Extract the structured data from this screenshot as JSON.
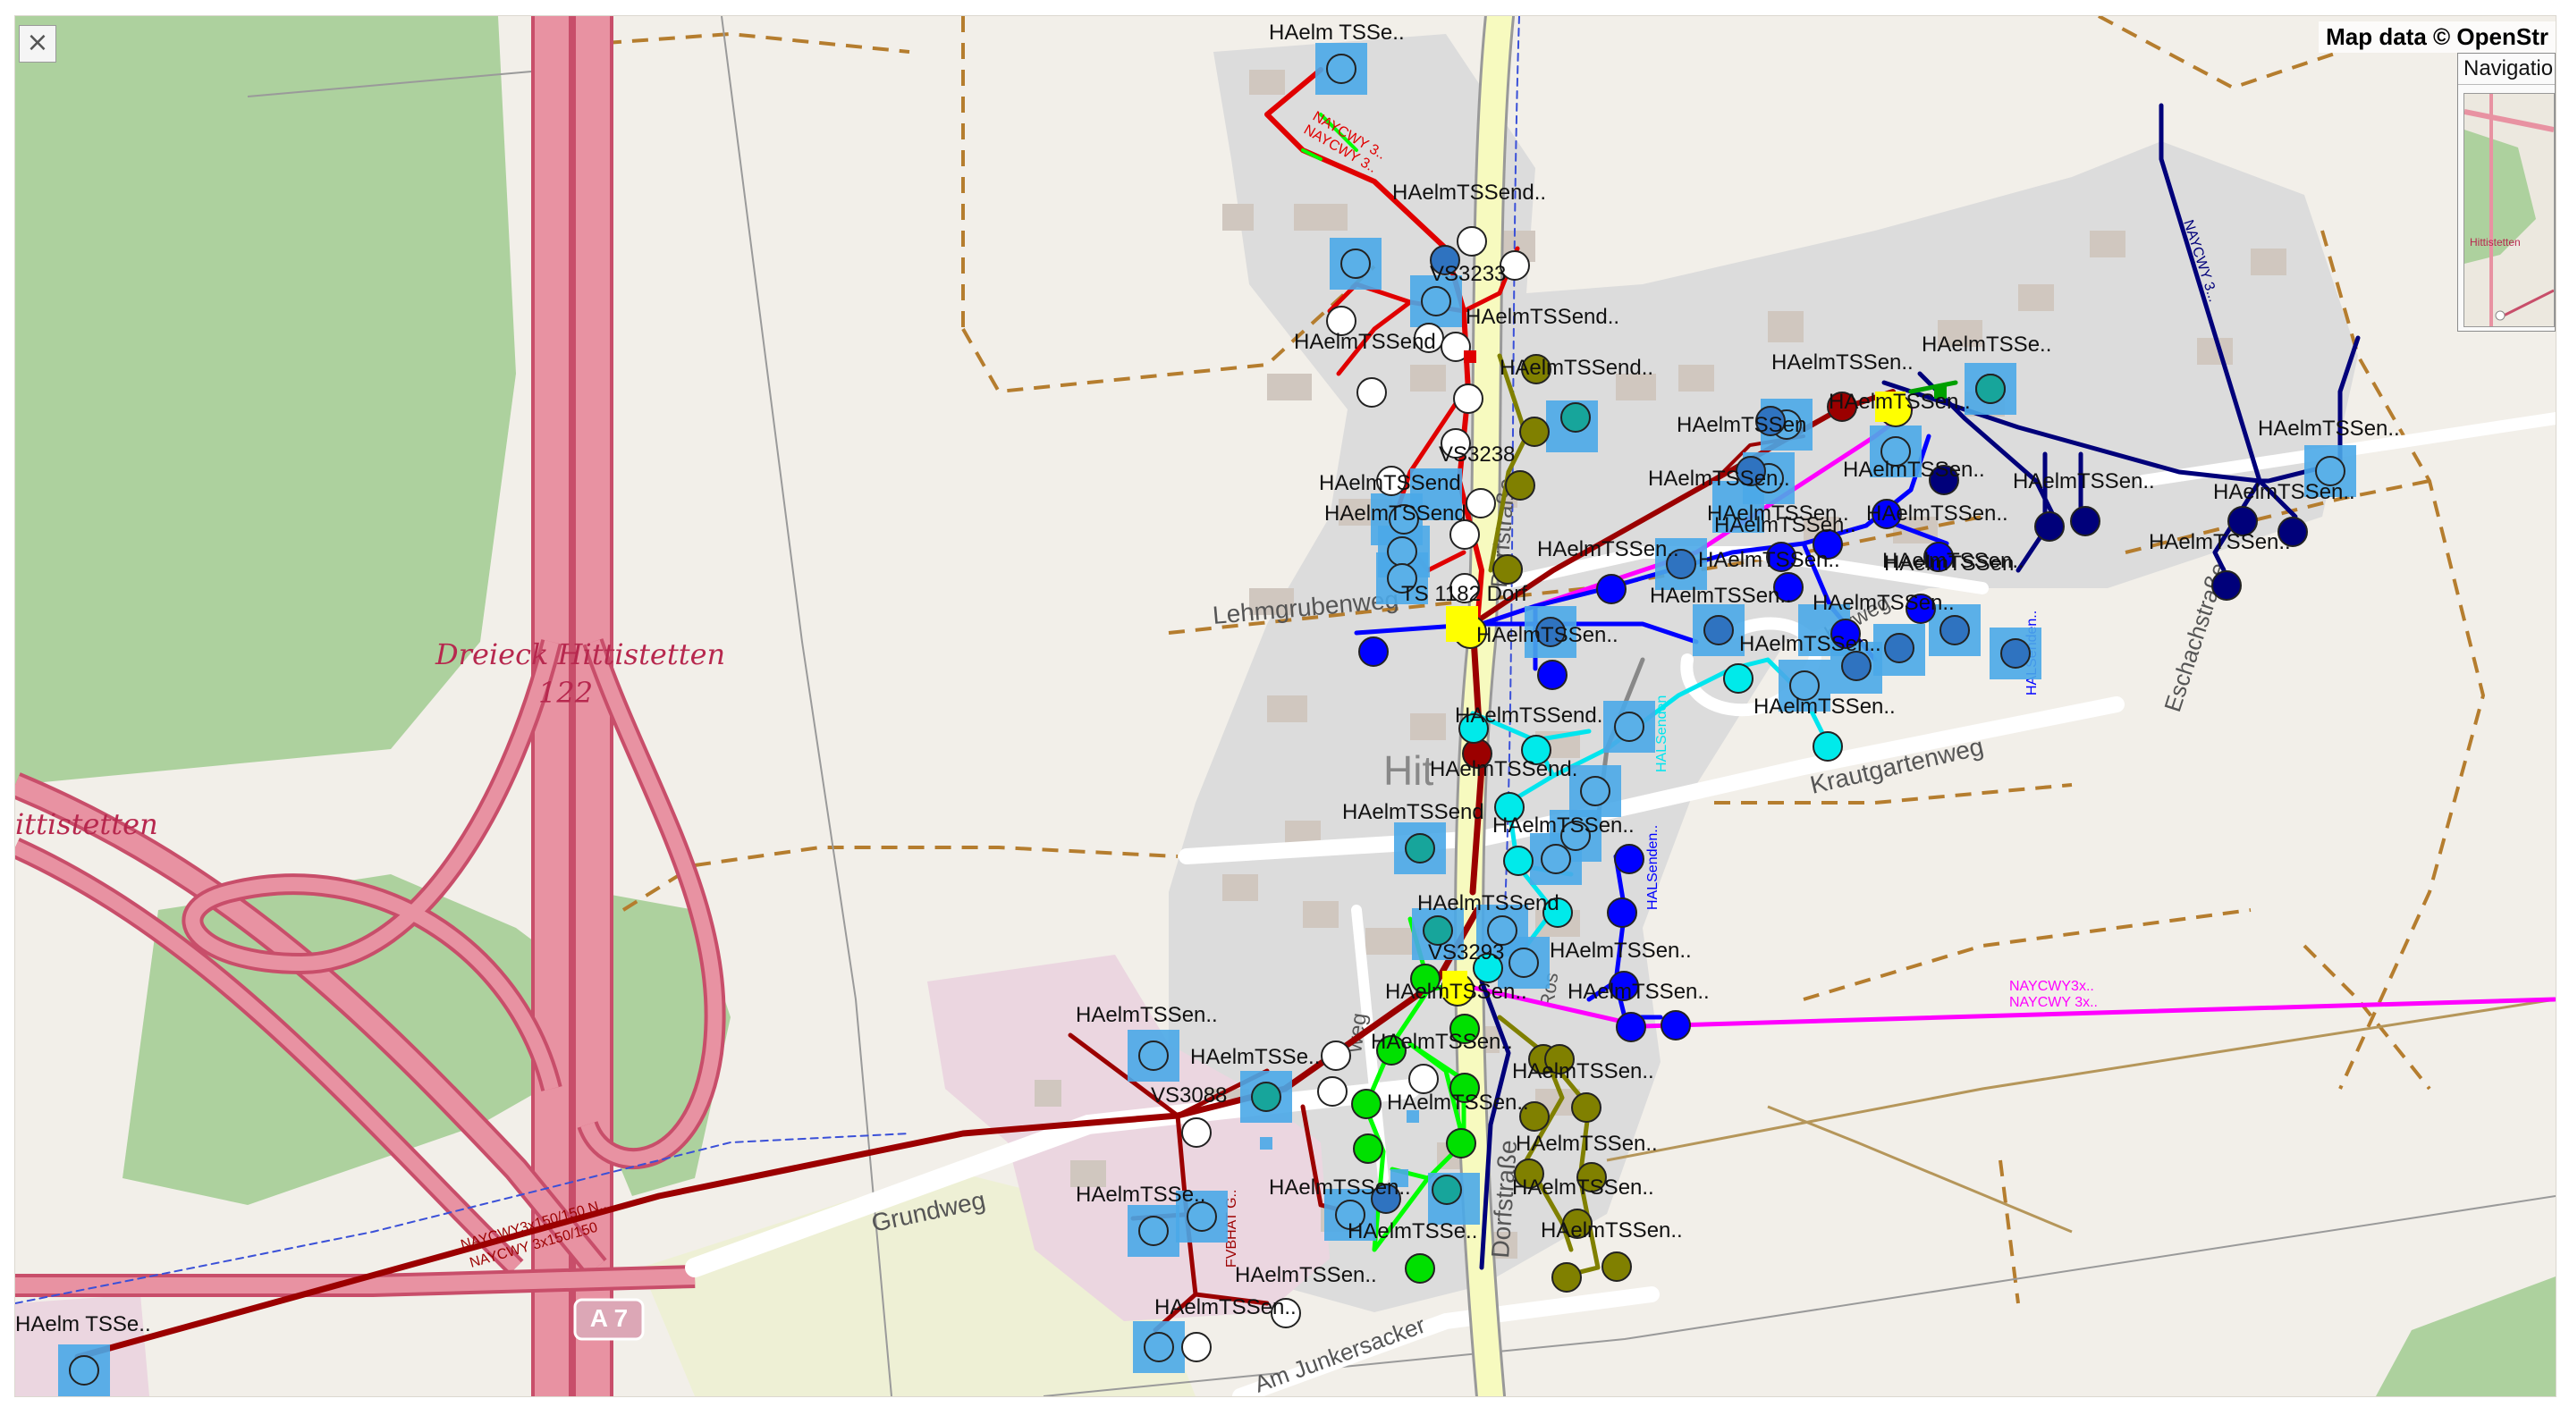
{
  "map": {
    "attribution": "Map data © OpenStr",
    "close_label": "×",
    "navigation_title": "Navigatio",
    "mini_label": "Hittistetten",
    "place_labels": {
      "interchange_name": "Dreieck Hittistetten",
      "interchange_number": "122",
      "village_left": "ittistetten",
      "village_center": "Hit"
    },
    "street_labels": {
      "lehmgrubenweg": "Lehmgrubenweg",
      "grundweg": "Grundweg",
      "krautgartenweg": "Krautgartenweg",
      "dorfstrasse_south": "Dorfstraße",
      "dorfstrasse_north": "Dorfstraße",
      "eschachstrasse": "Eschachstraße",
      "am_junkersacker": "Am Junkersacker",
      "weg_small": "weg",
      "roman_label": "Ros",
      "berg_label": "berweg",
      "highway_shield": "A 7"
    },
    "network_labels": {
      "ts_station": "TS 1182 Dorf",
      "vs3233": "VS3233",
      "vs3238": "VS3238",
      "vs3088": "VS3088",
      "vs3293": "VS3293",
      "ha_short_top": "HAelm TSSe..",
      "ha_short_bottom": "HAelm TSSe..",
      "ha_full_a": "HAelmTSSend..",
      "ha_full_b": "HAelmTSSend",
      "ha_mid": "HAelmTSSen..",
      "ha_plain": "HAelmTSSen",
      "ha_clip": "HAelmTSSend.",
      "ha_cut": "HAelmTSSe..",
      "ha_cut2": "HAelmTSSen.."
    },
    "cable_labels": {
      "naycwy_red_1": "NAYCWY 3..",
      "naycwy_red_2": "NAYCWY 3..",
      "naycwy_sw_1": "NAYCWY3x150/150 N..",
      "naycwy_sw_2": "NAYCWY 3x150/150",
      "naycwy_pink_1": "NAYCWY3x..",
      "naycwy_pink_2": "NAYCWY 3x..",
      "halsenden_1": "HALSenden..",
      "halsenden_2": "HALSenden..",
      "halsenden_3": "HALSenden",
      "fvbhat": "FVBHAT G..",
      "naycwy_navy": "NAYCWY 3..."
    },
    "colors": {
      "land": "#f2efe9",
      "forest": "#add19e",
      "motorway": "#e892a2",
      "motorway_border": "#c84e6a",
      "residential": "#d9d9d9",
      "building": "#d9d0c9",
      "industrial": "#ebdbe8",
      "farmland": "#eef0d5",
      "track": "#b57d2e",
      "main_road": "#f7fabf",
      "cable_red": "#e00000",
      "cable_darkred": "#9b0000",
      "cable_magenta": "#ff00ff",
      "cable_navy": "#00007a",
      "cable_blue": "#0000ff",
      "cable_cyan": "#00e5ee",
      "cable_green": "#00ff00",
      "cable_olive": "#808000",
      "cable_gray": "#888888",
      "node_square": "#4aa8e8",
      "station": "#ffff00"
    }
  }
}
